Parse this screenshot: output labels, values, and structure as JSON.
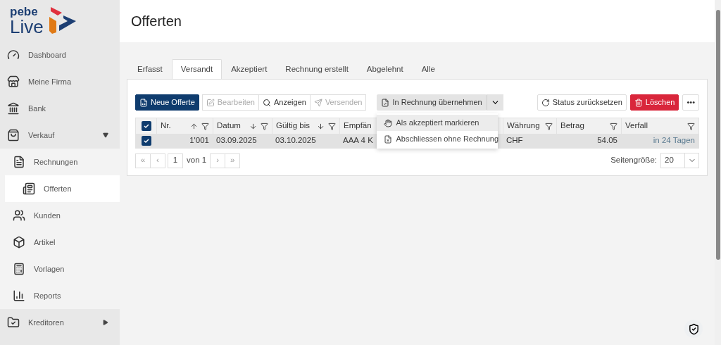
{
  "logo": {
    "line1": "pebe",
    "line2": "Live"
  },
  "sidebar": {
    "items": [
      {
        "label": "Dashboard",
        "selected": false
      },
      {
        "label": "Meine Firma",
        "selected": false
      },
      {
        "label": "Bank",
        "selected": false
      },
      {
        "label": "Verkauf",
        "selected": false,
        "expanded": true,
        "children": [
          {
            "label": "Rechnungen",
            "selected": false
          },
          {
            "label": "Offerten",
            "selected": true
          },
          {
            "label": "Kunden",
            "selected": false
          },
          {
            "label": "Artikel",
            "selected": false
          },
          {
            "label": "Vorlagen",
            "selected": false
          },
          {
            "label": "Reports",
            "selected": false
          }
        ]
      },
      {
        "label": "Kreditoren",
        "selected": false,
        "expanded": false
      }
    ]
  },
  "page_title": "Offerten",
  "tabs": [
    {
      "label": "Erfasst",
      "selected": false
    },
    {
      "label": "Versandt",
      "selected": true
    },
    {
      "label": "Akzeptiert",
      "selected": false
    },
    {
      "label": "Rechnung erstellt",
      "selected": false
    },
    {
      "label": "Abgelehnt",
      "selected": false
    },
    {
      "label": "Alle",
      "selected": false
    }
  ],
  "toolbar": [
    {
      "kind": "primary",
      "label": "Neue Offerte",
      "disabled": false
    },
    {
      "kind": "group",
      "items": [
        {
          "label": "Bearbeiten",
          "disabled": true
        },
        {
          "label": "Anzeigen",
          "disabled": false
        },
        {
          "label": "Versenden",
          "disabled": true
        }
      ]
    },
    {
      "kind": "split",
      "label": "In Rechnung übernehmen",
      "disabled": false,
      "expanded": true,
      "menu": [
        {
          "label": "Als akzeptiert markieren",
          "selected": true
        },
        {
          "label": "Abschliessen ohne Rechnung",
          "selected": false
        }
      ]
    },
    {
      "kind": "spacer"
    },
    {
      "kind": "outline",
      "label": "Status zurücksetzen",
      "disabled": false
    },
    {
      "kind": "danger",
      "label": "Löschen",
      "disabled": false
    },
    {
      "kind": "more",
      "label": "•••",
      "disabled": false
    }
  ],
  "table": {
    "all_checked": true,
    "columns": [
      {
        "label": "Nr.",
        "sorted": true,
        "descending": false,
        "filter": true
      },
      {
        "label": "Datum",
        "sorted": true,
        "descending": true,
        "filter": true
      },
      {
        "label": "Gültig bis",
        "sorted": true,
        "descending": true,
        "filter": true
      },
      {
        "label": "Empfän",
        "sorted": false,
        "filter": false
      },
      {
        "label": "Währung",
        "sorted": false,
        "filter": true
      },
      {
        "label": "Betrag",
        "sorted": false,
        "filter": true
      },
      {
        "label": "Verfall",
        "sorted": false,
        "filter": true
      }
    ],
    "rows": [
      {
        "selected": true,
        "checked": true,
        "cells": [
          "1'001",
          "03.09.2025",
          "03.10.2025",
          "AAA 4 K",
          "CHF",
          "54.05",
          "in 24 Tagen"
        ]
      }
    ]
  },
  "pager": {
    "first": "«",
    "prev": "‹",
    "page": "1",
    "of": "von 1",
    "next": "›",
    "last": "»",
    "page_size_label": "Seitengröße:",
    "page_size": "20"
  }
}
